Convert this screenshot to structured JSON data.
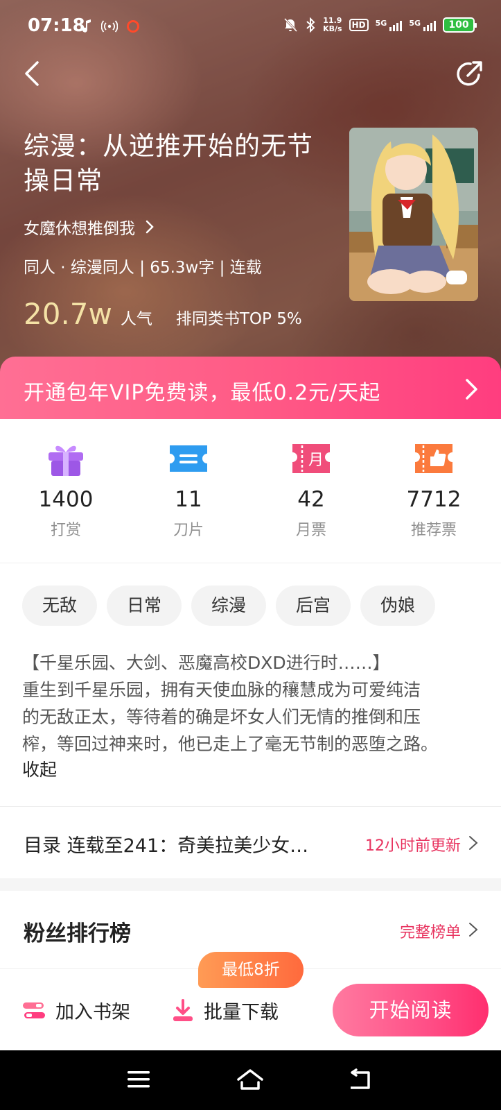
{
  "status_bar": {
    "time": "07:18",
    "speed_top": "11.9",
    "speed_bottom": "KB/s",
    "hd_label": "HD",
    "net1": "5G",
    "net2": "5G",
    "battery": "100"
  },
  "book": {
    "title": "综漫：从逆推开始的无节操日常",
    "author": "女魔休想推倒我",
    "meta": "同人 · 综漫同人 | 65.3w字 | 连载",
    "popularity_value": "20.7w",
    "popularity_label": "人气",
    "rank_text": "排同类书TOP 5%"
  },
  "vip_banner": {
    "text": "开通包年VIP免费读，最低0.2元/天起"
  },
  "stats": [
    {
      "icon": "gift-icon",
      "value": "1400",
      "label": "打赏"
    },
    {
      "icon": "blade-ticket-icon",
      "value": "11",
      "label": "刀片"
    },
    {
      "icon": "monthly-ticket-icon",
      "value": "42",
      "label": "月票"
    },
    {
      "icon": "recommend-ticket-icon",
      "value": "7712",
      "label": "推荐票"
    }
  ],
  "monthly_ticket_glyph": "月",
  "tags": [
    "无敌",
    "日常",
    "综漫",
    "后宫",
    "伪娘"
  ],
  "description": {
    "lines": [
      "【千星乐园、大剑、恶魔高校DXD进行时……】",
      "重生到千星乐园，拥有天使血脉的穰慧成为可爱纯洁",
      "的无敌正太，等待着的确是坏女人们无情的推倒和压",
      "榨，等回过神来时，他已走上了毫无节制的恶堕之路。"
    ],
    "collapse_label": "收起"
  },
  "toc": {
    "text": "目录 连载至241：奇美拉美少女…",
    "update": "12小时前更新"
  },
  "fans": {
    "title": "粉丝排行榜",
    "more": "完整榜单"
  },
  "actions": {
    "shelf_label": "加入书架",
    "download_label": "批量下载",
    "discount_badge": "最低8折",
    "read_label": "开始阅读"
  },
  "colors": {
    "accent": "#ff4f87",
    "update_red": "#e8335f",
    "popularity_gold": "#f4e2a6"
  }
}
